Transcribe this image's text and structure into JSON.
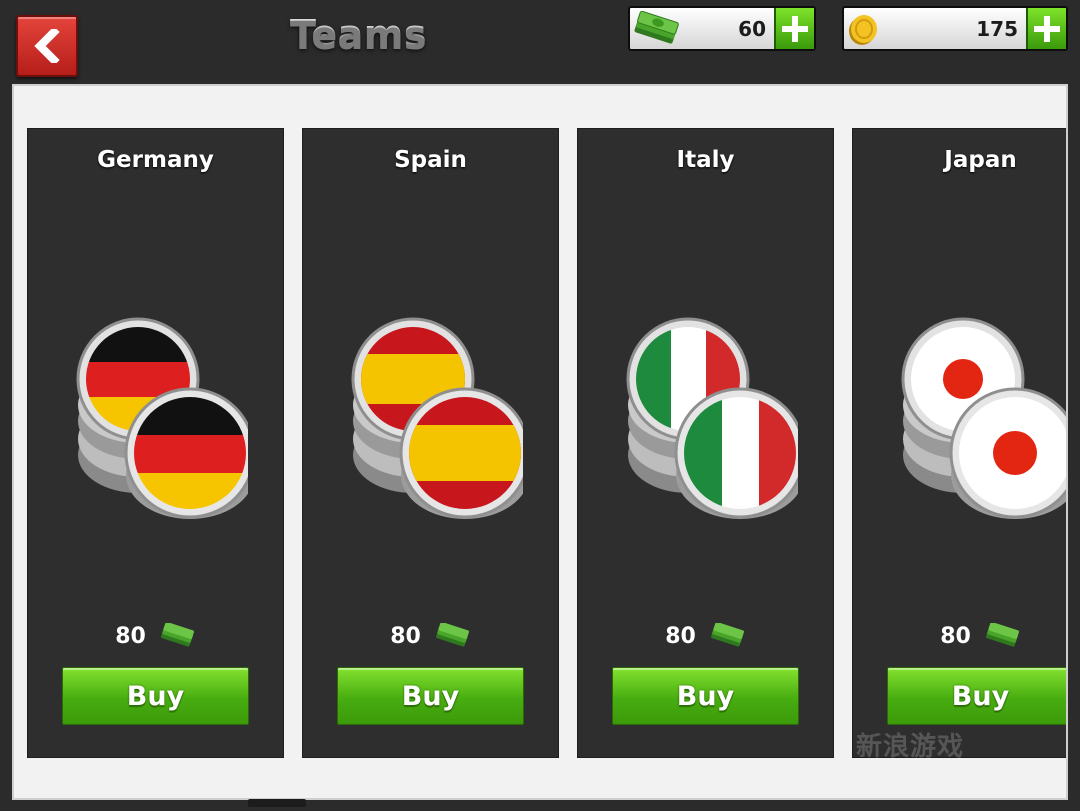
{
  "header": {
    "title": "Teams",
    "back_icon": "chevron-left-icon",
    "cash": {
      "icon": "cash-stack-icon",
      "value": "60",
      "plus_icon": "plus-icon"
    },
    "coins": {
      "icon": "gold-coin-icon",
      "value": "175",
      "plus_icon": "plus-icon"
    }
  },
  "teams": [
    {
      "name": "Germany",
      "price": "80",
      "price_icon": "cash-stack-icon",
      "buy_label": "Buy",
      "flag_icon": "germany-flag-coins-icon"
    },
    {
      "name": "Spain",
      "price": "80",
      "price_icon": "cash-stack-icon",
      "buy_label": "Buy",
      "flag_icon": "spain-flag-coins-icon"
    },
    {
      "name": "Italy",
      "price": "80",
      "price_icon": "cash-stack-icon",
      "buy_label": "Buy",
      "flag_icon": "italy-flag-coins-icon"
    },
    {
      "name": "Japan",
      "price": "80",
      "price_icon": "cash-stack-icon",
      "buy_label": "Buy",
      "flag_icon": "japan-flag-coins-icon"
    }
  ],
  "watermark": "新浪游戏",
  "colors": {
    "buy_green": "#4caf12",
    "back_red": "#d2302a",
    "card_bg": "#2e2e2e",
    "germany": [
      "#111111",
      "#dd1f1f",
      "#f7c400"
    ],
    "spain": [
      "#c8161d",
      "#f5c400",
      "#c8161d"
    ],
    "italy": [
      "#1d8a3d",
      "#ffffff",
      "#d22a2a"
    ],
    "japan": [
      "#ffffff",
      "#e32612"
    ]
  }
}
